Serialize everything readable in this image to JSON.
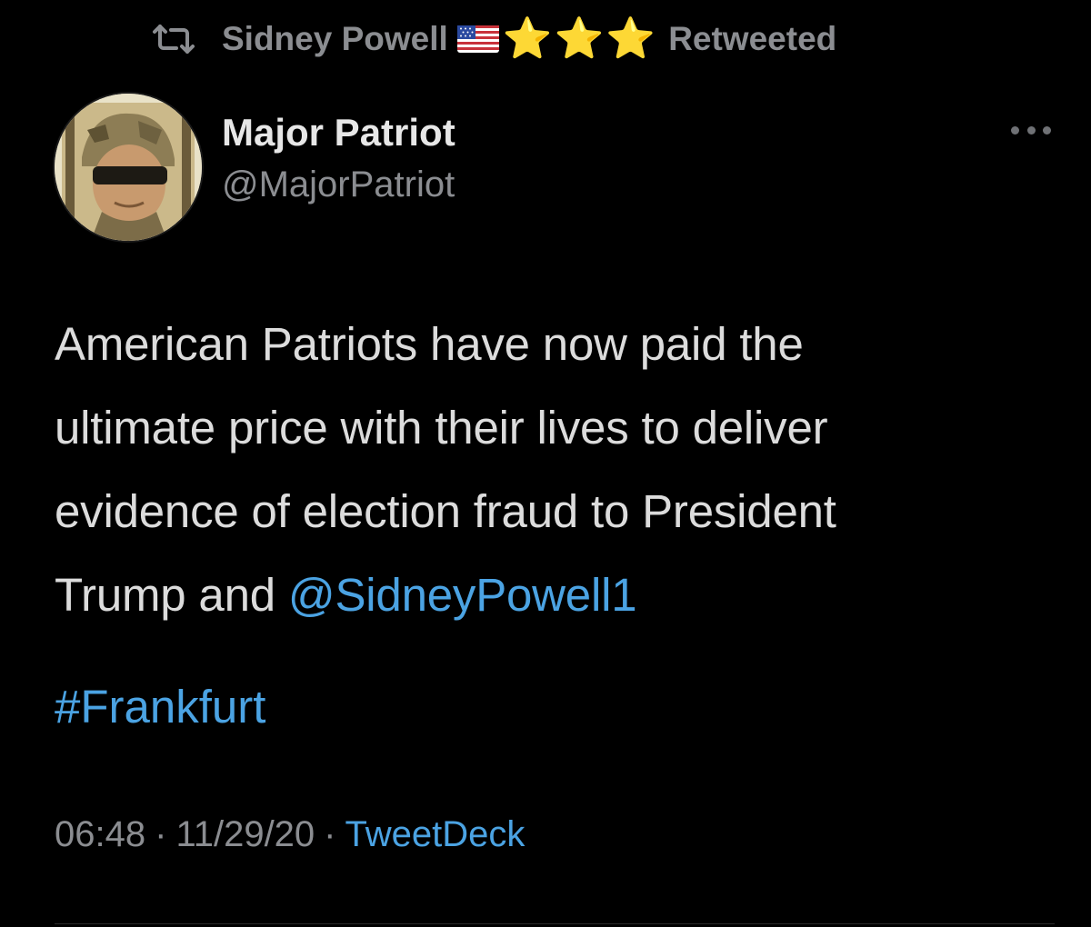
{
  "retweet_context": {
    "icon": "retweet-icon",
    "name": "Sidney Powell",
    "flag": "us-flag-emoji",
    "stars": [
      "⭐",
      "⭐",
      "⭐"
    ],
    "label": "Retweeted"
  },
  "author": {
    "display_name": "Major Patriot",
    "handle": "@MajorPatriot"
  },
  "tweet": {
    "line1": "American Patriots have now paid the",
    "line2": "ultimate price with their lives to deliver",
    "line3": "evidence of election fraud to President",
    "line4_text": "Trump and ",
    "mention": "@SidneyPowell1",
    "hashtag": "#Frankfurt"
  },
  "meta": {
    "time": "06:48",
    "separator": "·",
    "date": "11/29/20",
    "source": "TweetDeck"
  },
  "colors": {
    "background": "#000000",
    "link": "#4ba3e3",
    "secondary_text": "#8b8d91",
    "star": "#f7c12a"
  }
}
